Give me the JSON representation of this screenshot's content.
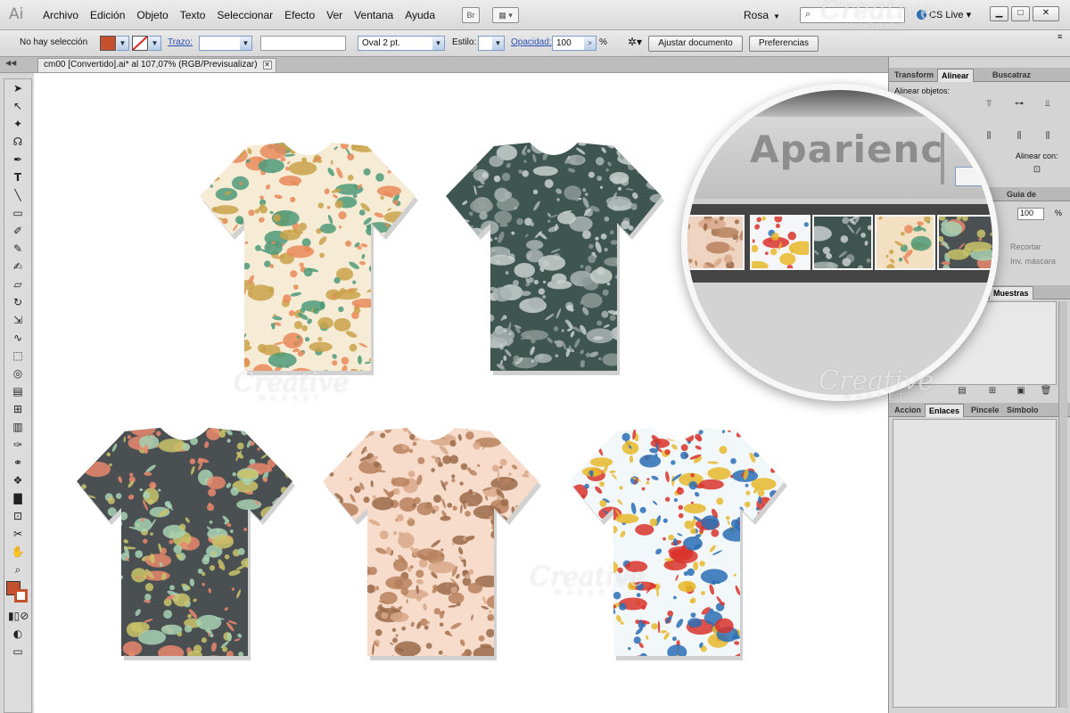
{
  "app": {
    "logo": "Ai",
    "menu": [
      "Archivo",
      "Edición",
      "Objeto",
      "Texto",
      "Seleccionar",
      "Efecto",
      "Ver",
      "Ventana",
      "Ayuda"
    ],
    "bridge_label": "Br",
    "workspace": "Rosa",
    "cs_live": "CS Live"
  },
  "control_bar": {
    "selection_status": "No hay selección",
    "fill_color": "#c5502e",
    "stroke_label": "Trazo:",
    "brush_value": "Oval 2 pt.",
    "style_label": "Estilo:",
    "opacity_label": "Opacidad:",
    "opacity_value": "100",
    "opacity_unit": "%",
    "fit_document_button": "Ajustar documento",
    "preferences_button": "Preferencias"
  },
  "document": {
    "tab_title": "cm00 [Convertido].ai* al 107,07% (RGB/Previsualizar)"
  },
  "panels": {
    "top_tabs": [
      "Transform",
      "Alinear",
      "Buscatraz"
    ],
    "align_objects_label": "Alinear objetos:",
    "align_with_label": "Alinear con:",
    "guide_tab": "Guía de",
    "opacity_value": "100",
    "opacity_unit": "%",
    "clip_label": "Recortar",
    "invert_mask_label": "Inv. máscara",
    "swatches_tab": "Muestras",
    "bottom_tabs": [
      "Accion",
      "Enlaces",
      "Pincele",
      "Símbolo"
    ]
  },
  "magnifier": {
    "zoomed_title": "Aparienc"
  },
  "watermark": {
    "brand": "Creative",
    "sub": "MARKET"
  },
  "shirts": [
    {
      "name": "cream",
      "bg": "#f6ecd6",
      "accent1": "#e98a5a",
      "accent2": "#4e9a78",
      "accent3": "#c9a24a"
    },
    {
      "name": "slate-gray",
      "bg": "#3f5650",
      "accent1": "#a9b4b1",
      "accent2": "#c9d0ce",
      "accent3": "#8d9995"
    },
    {
      "name": "dark-gray",
      "bg": "#4a5052",
      "accent1": "#e9876d",
      "accent2": "#a7d1b3",
      "accent3": "#c9c36a"
    },
    {
      "name": "peach",
      "bg": "#f8dccb",
      "accent1": "#b7815d",
      "accent2": "#d8a889",
      "accent3": "#9a6a4a"
    },
    {
      "name": "white",
      "bg": "#f2f7fa",
      "accent1": "#d9342b",
      "accent2": "#2a6fb5",
      "accent3": "#e7b82b"
    }
  ],
  "mag_swatches": [
    {
      "name": "peach",
      "bg": "#f0d4c2"
    },
    {
      "name": "white",
      "bg": "#f4f6f8"
    },
    {
      "name": "slate",
      "bg": "#40544f"
    },
    {
      "name": "cream",
      "bg": "#f3e0c2"
    },
    {
      "name": "dark",
      "bg": "#4b5153"
    }
  ]
}
